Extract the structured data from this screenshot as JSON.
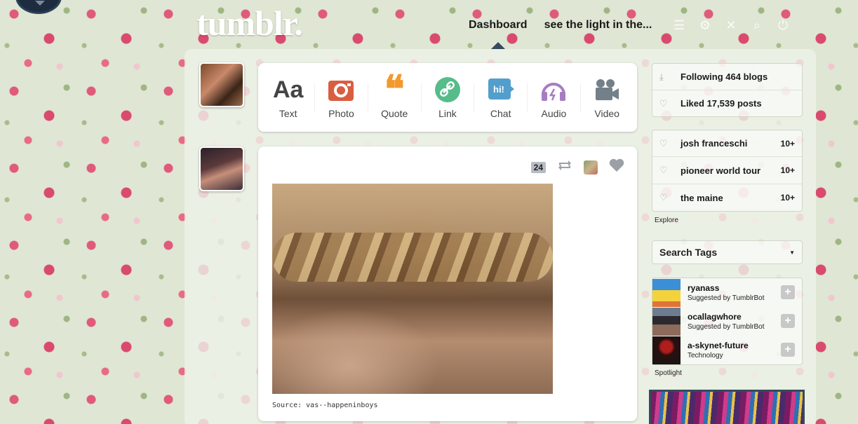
{
  "header": {
    "logo": "tumblr.",
    "nav": [
      "Dashboard",
      "see the light in the..."
    ],
    "icons": [
      "menu-icon",
      "settings-icon",
      "close-icon",
      "search-icon",
      "power-icon"
    ]
  },
  "post_types": [
    {
      "label": "Text",
      "icon": "text-icon",
      "color": "#444444"
    },
    {
      "label": "Photo",
      "icon": "camera-icon",
      "color": "#d95e40"
    },
    {
      "label": "Quote",
      "icon": "quote-icon",
      "color": "#f2992e"
    },
    {
      "label": "Link",
      "icon": "link-icon",
      "color": "#56bc8a"
    },
    {
      "label": "Chat",
      "icon": "chat-icon",
      "color": "#529ecc"
    },
    {
      "label": "Audio",
      "icon": "headphones-icon",
      "color": "#a77dc2"
    },
    {
      "label": "Video",
      "icon": "video-camera-icon",
      "color": "#748089"
    }
  ],
  "post": {
    "notes_count": "24",
    "source": "Source: vas--happeninboys"
  },
  "sidebar": {
    "stats": [
      "Following 464 blogs",
      "Liked 17,539 posts"
    ],
    "tracked": [
      {
        "name": "josh franceschi",
        "count": "10+"
      },
      {
        "name": "pioneer world tour",
        "count": "10+"
      },
      {
        "name": "the maine",
        "count": "10+"
      }
    ],
    "explore_label": "Explore",
    "search_tags": "Search Tags",
    "suggestions": [
      {
        "name": "ryanass",
        "sub": "Suggested by TumblrBot"
      },
      {
        "name": "ocallagwhore",
        "sub": "Suggested by TumblrBot"
      },
      {
        "name": "a-skynet-future",
        "sub": "Technology"
      }
    ],
    "spotlight_label": "Spotlight"
  }
}
